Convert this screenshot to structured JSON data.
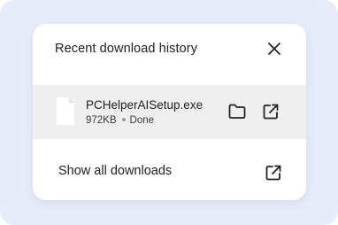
{
  "panel": {
    "title": "Recent download history",
    "close_icon": "close-icon"
  },
  "downloads": [
    {
      "filename": "PCHelperAISetup.exe",
      "size": "972KB",
      "status": "Done",
      "icons": [
        "file-icon",
        "folder-icon",
        "open-external-icon"
      ]
    }
  ],
  "footer": {
    "show_all_label": "Show all downloads",
    "icon": "open-external-icon"
  },
  "colors": {
    "background": "#e6ecf9",
    "panel": "#ffffff",
    "row_highlight": "#efefef",
    "text": "#222222"
  }
}
